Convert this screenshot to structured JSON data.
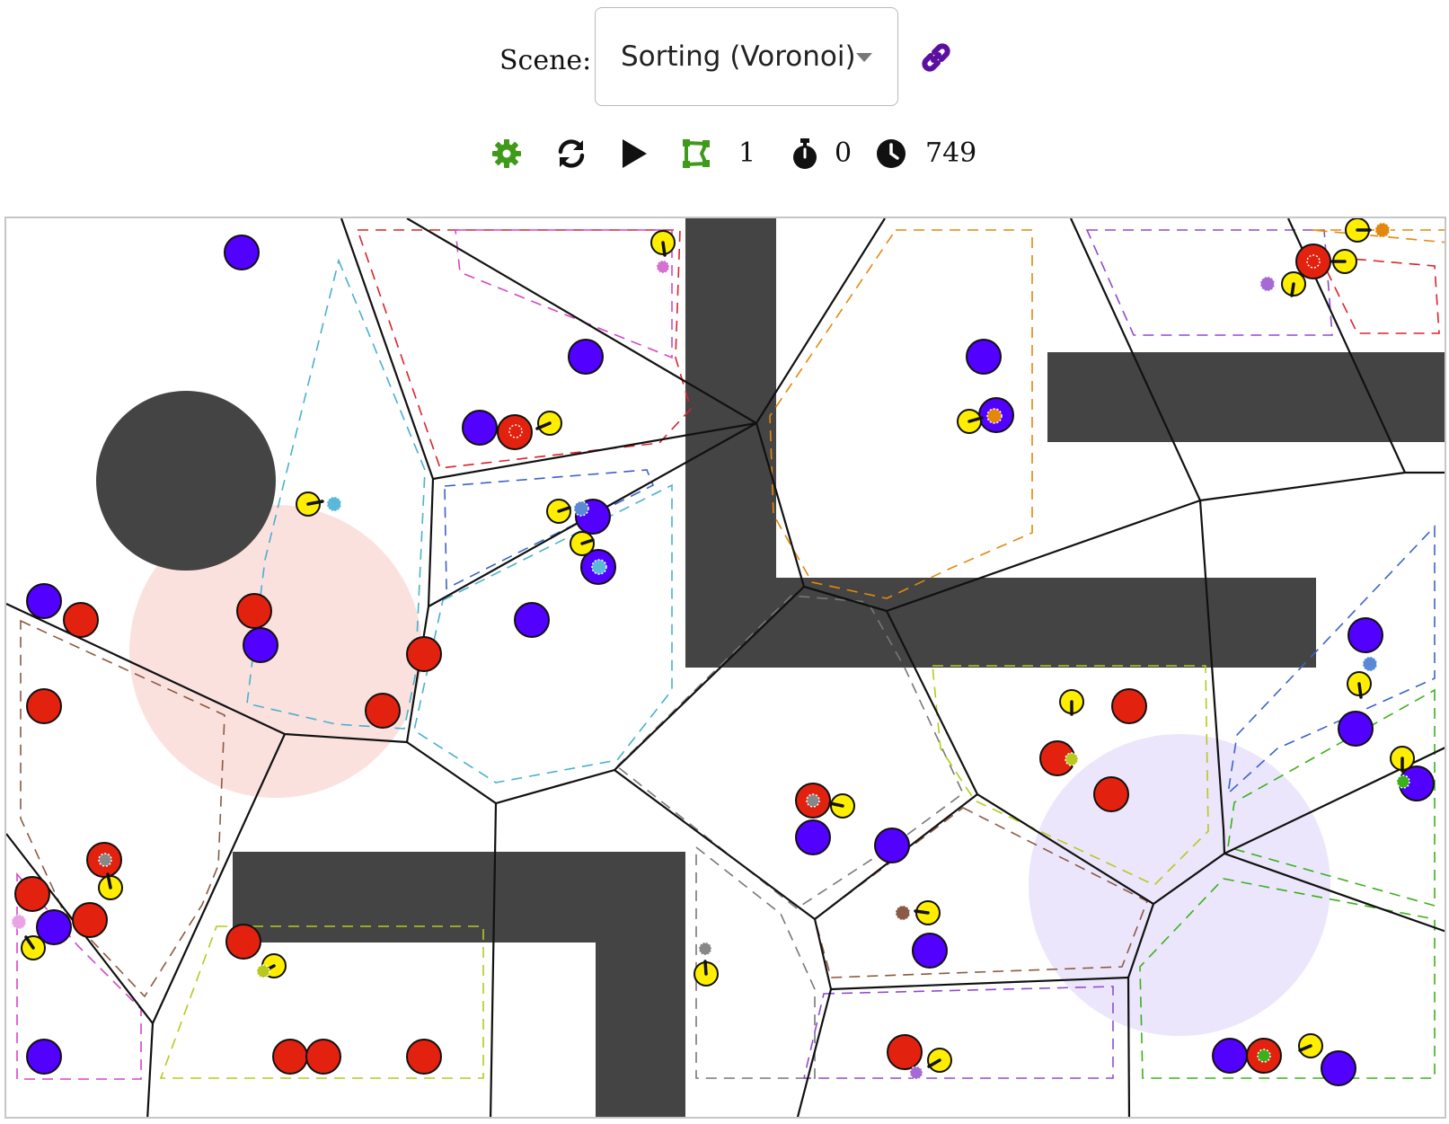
{
  "scene": {
    "label": "Scene:",
    "selected": "Sorting (Voronoi)"
  },
  "toolbar": {
    "settings_icon": "gear-icon",
    "reset_icon": "refresh-icon",
    "play_icon": "play-icon",
    "boundary_icon": "shape-icon",
    "boundary_count": "1",
    "stopwatch_icon": "stopwatch-icon",
    "stopwatch_value": "0",
    "clock_icon": "clock-icon",
    "clock_value": "749"
  },
  "colors": {
    "obstacle": "#444444",
    "red_puck": "#e3210f",
    "blue_puck": "#5200ff",
    "robot": "#ffee00",
    "goal_red": "#f9dcd8",
    "goal_blue": "#e9e3fb",
    "link": "#5c0f9e",
    "settings": "#3f9a1a",
    "boundary": "#3f9a1a"
  }
}
